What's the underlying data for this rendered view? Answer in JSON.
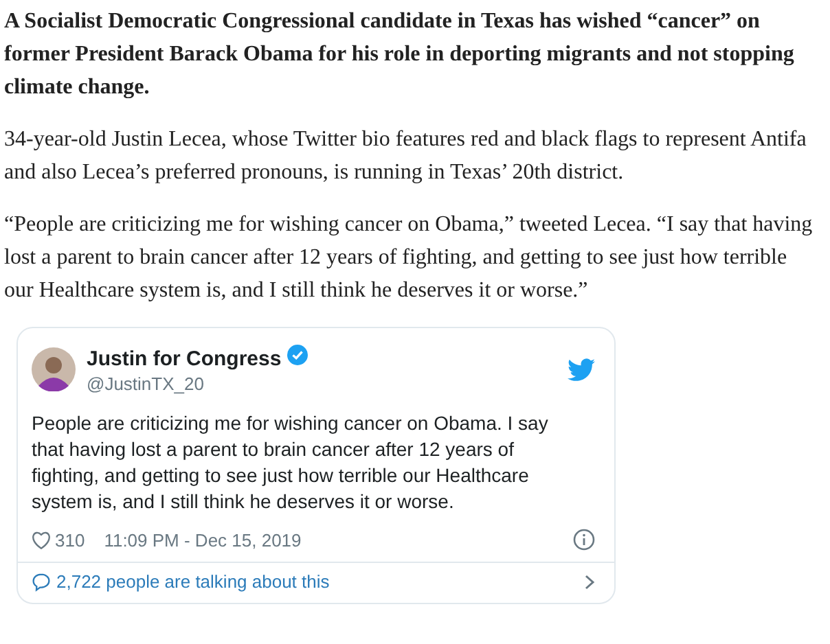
{
  "article": {
    "lead": "A Socialist Democratic Congressional candidate in Texas has wished “cancer” on former President Barack Obama for his role in deporting migrants and not stopping climate change.",
    "paragraphs": [
      "34-year-old Justin Lecea, whose Twitter bio features red and black flags to represent Antifa and also Lecea’s preferred pronouns, is running in Texas’ 20th district.",
      "“People are criticizing me for wishing cancer on Obama,” tweeted Lecea. “I say that having lost a parent to brain cancer after 12 years of fighting, and getting to see just how terrible our Healthcare system is, and I still think he deserves it or worse.”"
    ]
  },
  "tweet": {
    "name": "Justin for Congress",
    "verified": true,
    "handle": "@JustinTX_20",
    "text": "People are criticizing me for wishing cancer on Obama. I say that having lost a parent to brain cancer after 12 years of fighting, and getting to see just how terrible our Healthcare system is, and I still think he deserves it or worse.",
    "likes": "310",
    "timestamp": "11:09 PM - Dec 15, 2019",
    "talking": "2,722 people are talking about this"
  }
}
